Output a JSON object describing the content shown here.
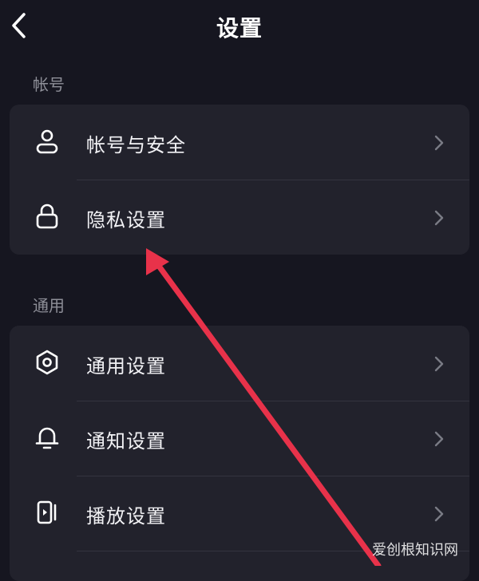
{
  "header": {
    "title": "设置",
    "back_icon": "chevron-left-icon"
  },
  "sections": [
    {
      "label": "帐号",
      "items": [
        {
          "label": "帐号与安全",
          "icon": "person-icon"
        },
        {
          "label": "隐私设置",
          "icon": "lock-icon"
        }
      ]
    },
    {
      "label": "通用",
      "items": [
        {
          "label": "通用设置",
          "icon": "gear-icon"
        },
        {
          "label": "通知设置",
          "icon": "bell-icon"
        },
        {
          "label": "播放设置",
          "icon": "play-device-icon"
        }
      ]
    }
  ],
  "annotation": {
    "color": "#e8324a"
  },
  "watermark": "爱创根知识网",
  "colors": {
    "background": "#161620",
    "card": "#22222c",
    "section_label": "#8e8f98",
    "chevron": "#7a7b85"
  }
}
